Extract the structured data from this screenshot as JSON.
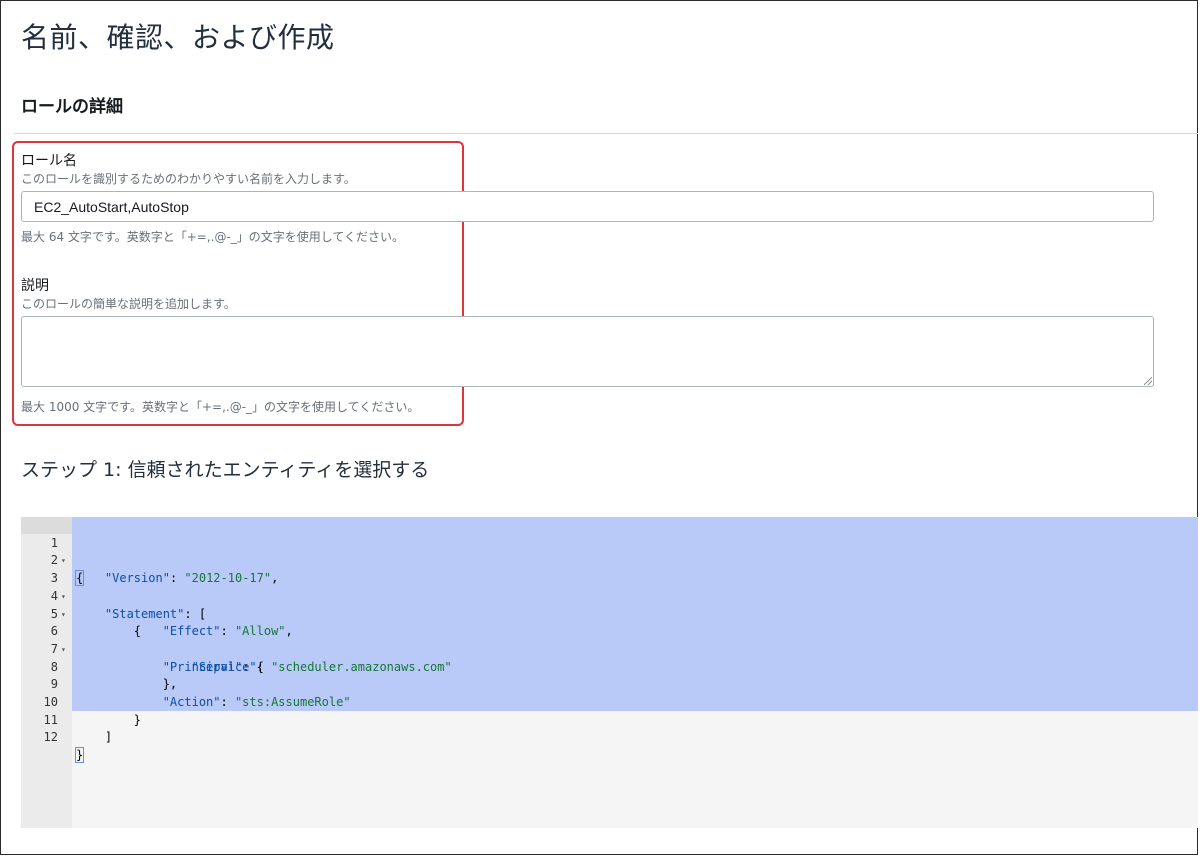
{
  "page": {
    "title": "名前、確認、および作成",
    "section_title": "ロールの詳細"
  },
  "role_name": {
    "label": "ロール名",
    "description": "このロールを識別するためのわかりやすい名前を入力します。",
    "value": "EC2_AutoStart,AutoStop",
    "hint": "最大 64 文字です。英数字と「+=,.@-_」の文字を使用してください。"
  },
  "role_description": {
    "label": "説明",
    "description": "このロールの簡単な説明を追加します。",
    "value": "",
    "hint": "最大 1000 文字です。英数字と「+=,.@-_」の文字を使用してください。"
  },
  "step1": {
    "title": "ステップ 1: 信頼されたエンティティを選択する"
  },
  "policy_editor": {
    "lines": [
      {
        "n": "1",
        "fold": true
      },
      {
        "n": "2",
        "fold": false
      },
      {
        "n": "3",
        "fold": true
      },
      {
        "n": "4",
        "fold": true
      },
      {
        "n": "5",
        "fold": false
      },
      {
        "n": "6",
        "fold": true
      },
      {
        "n": "7",
        "fold": false
      },
      {
        "n": "8",
        "fold": false
      },
      {
        "n": "9",
        "fold": false
      },
      {
        "n": "10",
        "fold": false
      },
      {
        "n": "11",
        "fold": false
      },
      {
        "n": "12",
        "fold": false
      }
    ],
    "tokens": {
      "version_key": "\"Version\"",
      "version_val": "\"2012-10-17\"",
      "statement_key": "\"Statement\"",
      "effect_key": "\"Effect\"",
      "effect_val": "\"Allow\"",
      "principal_key": "\"Principal\"",
      "service_key": "\"Service\"",
      "service_val": "\"scheduler.amazonaws.com\"",
      "action_key": "\"Action\"",
      "action_val": "\"sts:AssumeRole\""
    }
  }
}
